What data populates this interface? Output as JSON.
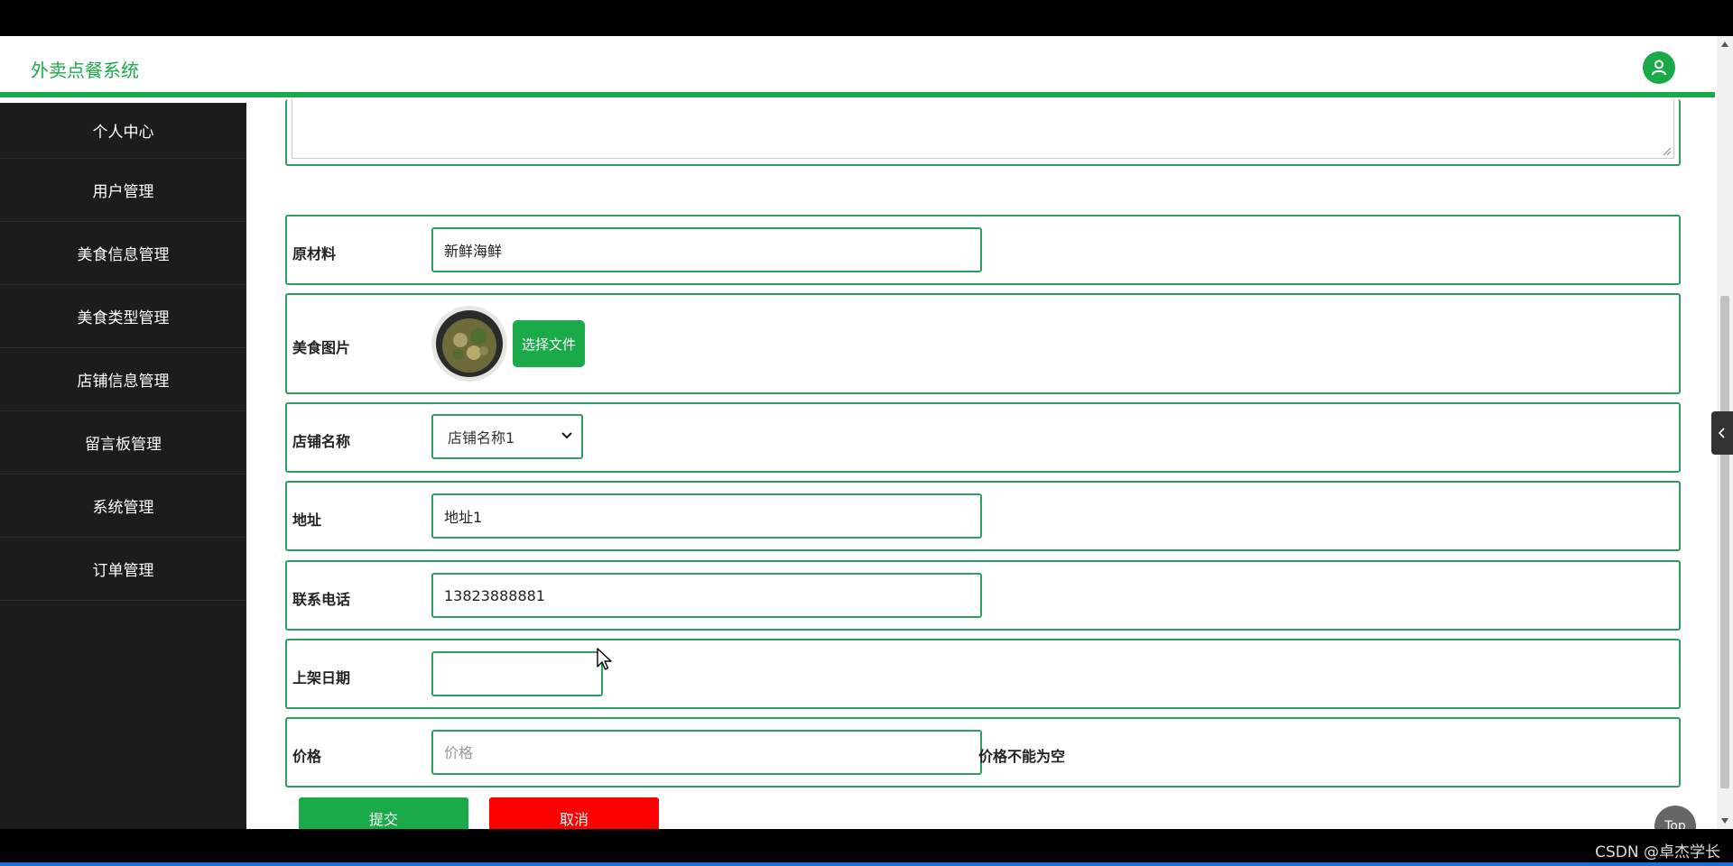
{
  "app": {
    "title": "外卖点餐系统",
    "accent_color": "#1aaa4a"
  },
  "sidebar": {
    "items": [
      {
        "label": "个人中心"
      },
      {
        "label": "用户管理"
      },
      {
        "label": "美食信息管理"
      },
      {
        "label": "美食类型管理"
      },
      {
        "label": "店铺信息管理"
      },
      {
        "label": "留言板管理"
      },
      {
        "label": "系统管理"
      },
      {
        "label": "订单管理"
      }
    ]
  },
  "form": {
    "ingredients": {
      "label": "原材料",
      "value": "新鲜海鲜"
    },
    "image": {
      "label": "美食图片",
      "button": "选择文件"
    },
    "shop_name": {
      "label": "店铺名称",
      "selected": "店铺名称1"
    },
    "address": {
      "label": "地址",
      "value": "地址1"
    },
    "phone": {
      "label": "联系电话",
      "value": "13823888881"
    },
    "listing_date": {
      "label": "上架日期",
      "value": ""
    },
    "price": {
      "label": "价格",
      "placeholder": "价格",
      "error": "价格不能为空"
    },
    "submit_label": "提交",
    "cancel_label": "取消"
  },
  "top_button_label": "Top",
  "watermark": "CSDN @卓杰学长"
}
